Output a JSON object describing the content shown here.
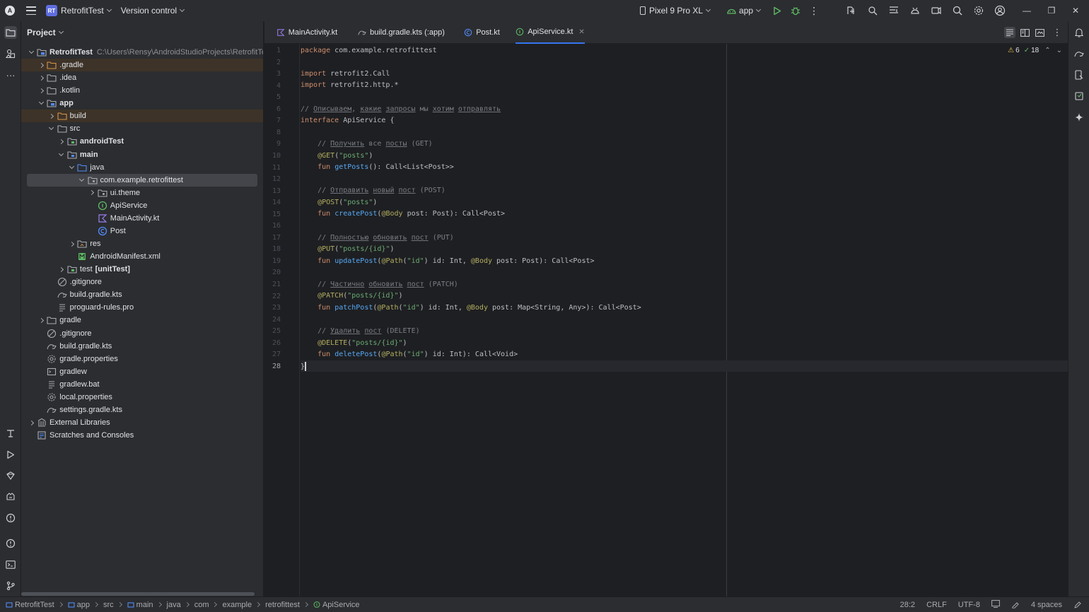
{
  "titlebar": {
    "project_badge": "RT",
    "project_name": "RetrofitTest",
    "vcs_label": "Version control",
    "device": "Pixel 9 Pro XL",
    "run_config": "app"
  },
  "project_panel": {
    "title": "Project",
    "tree": [
      {
        "label": "RetrofitTest",
        "path": "C:\\Users\\Rensy\\AndroidStudioProjects\\RetrofitTest",
        "depth": 0,
        "expander": "open",
        "icon": "module",
        "bold": true
      },
      {
        "label": ".gradle",
        "depth": 1,
        "expander": "closed",
        "icon": "folder-orange",
        "bg": "ignored"
      },
      {
        "label": ".idea",
        "depth": 1,
        "expander": "closed",
        "icon": "folder"
      },
      {
        "label": ".kotlin",
        "depth": 1,
        "expander": "closed",
        "icon": "folder"
      },
      {
        "label": "app",
        "depth": 1,
        "expander": "open",
        "icon": "module",
        "bold": true
      },
      {
        "label": "build",
        "depth": 2,
        "expander": "closed",
        "icon": "folder-orange",
        "bg": "ignored"
      },
      {
        "label": "src",
        "depth": 2,
        "expander": "open",
        "icon": "folder"
      },
      {
        "label": "androidTest",
        "depth": 3,
        "expander": "closed",
        "icon": "folder-test",
        "bold": true
      },
      {
        "label": "main",
        "depth": 3,
        "expander": "open",
        "icon": "folder-src",
        "bold": true
      },
      {
        "label": "java",
        "depth": 4,
        "expander": "open",
        "icon": "folder-blue"
      },
      {
        "label": "com.example.retrofittest",
        "depth": 5,
        "expander": "open",
        "icon": "package",
        "bg": "selected"
      },
      {
        "label": "ui.theme",
        "depth": 6,
        "expander": "closed",
        "icon": "package"
      },
      {
        "label": "ApiService",
        "depth": 6,
        "expander": "none",
        "icon": "kotlin-interface"
      },
      {
        "label": "MainActivity.kt",
        "depth": 6,
        "expander": "none",
        "icon": "kotlin-file"
      },
      {
        "label": "Post",
        "depth": 6,
        "expander": "none",
        "icon": "kotlin-class"
      },
      {
        "label": "res",
        "depth": 4,
        "expander": "closed",
        "icon": "folder-res"
      },
      {
        "label": "AndroidManifest.xml",
        "depth": 4,
        "expander": "none",
        "icon": "manifest"
      },
      {
        "label": "test",
        "suffix": "[unitTest]",
        "depth": 3,
        "expander": "closed",
        "icon": "folder-test"
      },
      {
        "label": ".gitignore",
        "depth": 2,
        "expander": "none",
        "icon": "gitignore"
      },
      {
        "label": "build.gradle.kts",
        "depth": 2,
        "expander": "none",
        "icon": "gradle"
      },
      {
        "label": "proguard-rules.pro",
        "depth": 2,
        "expander": "none",
        "icon": "text-file"
      },
      {
        "label": "gradle",
        "depth": 1,
        "expander": "closed",
        "icon": "folder"
      },
      {
        "label": ".gitignore",
        "depth": 1,
        "expander": "none",
        "icon": "gitignore"
      },
      {
        "label": "build.gradle.kts",
        "depth": 1,
        "expander": "none",
        "icon": "gradle"
      },
      {
        "label": "gradle.properties",
        "depth": 1,
        "expander": "none",
        "icon": "settings-file"
      },
      {
        "label": "gradlew",
        "depth": 1,
        "expander": "none",
        "icon": "terminal-file"
      },
      {
        "label": "gradlew.bat",
        "depth": 1,
        "expander": "none",
        "icon": "text-file"
      },
      {
        "label": "local.properties",
        "depth": 1,
        "expander": "none",
        "icon": "settings-file"
      },
      {
        "label": "settings.gradle.kts",
        "depth": 1,
        "expander": "none",
        "icon": "gradle"
      },
      {
        "label": "External Libraries",
        "depth": 0,
        "expander": "closed",
        "icon": "library"
      },
      {
        "label": "Scratches and Consoles",
        "depth": 0,
        "expander": "none",
        "icon": "scratches"
      }
    ]
  },
  "tabs": [
    {
      "label": "MainActivity.kt",
      "icon": "kotlin-file",
      "active": false
    },
    {
      "label": "build.gradle.kts (:app)",
      "icon": "gradle",
      "active": false
    },
    {
      "label": "Post.kt",
      "icon": "kotlin-class",
      "active": false
    },
    {
      "label": "ApiService.kt",
      "icon": "kotlin-interface",
      "active": true
    }
  ],
  "inspections": {
    "warnings": "6",
    "weak_warnings": "18"
  },
  "editor": {
    "current_line": 28,
    "lines": [
      [
        [
          "k",
          "package "
        ],
        [
          "p",
          "com.example.retrofittest"
        ]
      ],
      [],
      [
        [
          "k",
          "import "
        ],
        [
          "p",
          "retrofit2.Call"
        ]
      ],
      [
        [
          "k",
          "import "
        ],
        [
          "p",
          "retrofit2.http.*"
        ]
      ],
      [],
      [
        [
          "c",
          "// "
        ],
        [
          "cu",
          "Описываем"
        ],
        [
          "c",
          ", "
        ],
        [
          "cu",
          "какие"
        ],
        [
          "c",
          " "
        ],
        [
          "cu",
          "запросы"
        ],
        [
          "c",
          " мы "
        ],
        [
          "cu",
          "хотим"
        ],
        [
          "c",
          " "
        ],
        [
          "cu",
          "отправлять"
        ]
      ],
      [
        [
          "k",
          "interface "
        ],
        [
          "p",
          "ApiService {"
        ]
      ],
      [],
      [
        [
          "p",
          "    "
        ],
        [
          "c",
          "// "
        ],
        [
          "cu",
          "Получить"
        ],
        [
          "c",
          " все "
        ],
        [
          "cu",
          "посты"
        ],
        [
          "c",
          " (GET)"
        ]
      ],
      [
        [
          "p",
          "    "
        ],
        [
          "a",
          "@GET"
        ],
        [
          "p",
          "("
        ],
        [
          "s",
          "\"posts\""
        ],
        [
          "p",
          ")"
        ]
      ],
      [
        [
          "p",
          "    "
        ],
        [
          "k",
          "fun "
        ],
        [
          "f",
          "getPosts"
        ],
        [
          "p",
          "(): Call<List<Post>>"
        ]
      ],
      [],
      [
        [
          "p",
          "    "
        ],
        [
          "c",
          "// "
        ],
        [
          "cu",
          "Отправить"
        ],
        [
          "c",
          " "
        ],
        [
          "cu",
          "новый"
        ],
        [
          "c",
          " "
        ],
        [
          "cu",
          "пост"
        ],
        [
          "c",
          " (POST)"
        ]
      ],
      [
        [
          "p",
          "    "
        ],
        [
          "a",
          "@POST"
        ],
        [
          "p",
          "("
        ],
        [
          "s",
          "\"posts\""
        ],
        [
          "p",
          ")"
        ]
      ],
      [
        [
          "p",
          "    "
        ],
        [
          "k",
          "fun "
        ],
        [
          "f",
          "createPost"
        ],
        [
          "p",
          "("
        ],
        [
          "a",
          "@Body "
        ],
        [
          "p",
          "post: Post): Call<Post>"
        ]
      ],
      [],
      [
        [
          "p",
          "    "
        ],
        [
          "c",
          "// "
        ],
        [
          "cu",
          "Полностью"
        ],
        [
          "c",
          " "
        ],
        [
          "cu",
          "обновить"
        ],
        [
          "c",
          " "
        ],
        [
          "cu",
          "пост"
        ],
        [
          "c",
          " (PUT)"
        ]
      ],
      [
        [
          "p",
          "    "
        ],
        [
          "a",
          "@PUT"
        ],
        [
          "p",
          "("
        ],
        [
          "s",
          "\"posts/{id}\""
        ],
        [
          "p",
          ")"
        ]
      ],
      [
        [
          "p",
          "    "
        ],
        [
          "k",
          "fun "
        ],
        [
          "f",
          "updatePost"
        ],
        [
          "p",
          "("
        ],
        [
          "a",
          "@Path"
        ],
        [
          "p",
          "("
        ],
        [
          "s",
          "\"id\""
        ],
        [
          "p",
          ") id: Int, "
        ],
        [
          "a",
          "@Body "
        ],
        [
          "p",
          "post: Post): Call<Post>"
        ]
      ],
      [],
      [
        [
          "p",
          "    "
        ],
        [
          "c",
          "// "
        ],
        [
          "cu",
          "Частично"
        ],
        [
          "c",
          " "
        ],
        [
          "cu",
          "обновить"
        ],
        [
          "c",
          " "
        ],
        [
          "cu",
          "пост"
        ],
        [
          "c",
          " (PATCH)"
        ]
      ],
      [
        [
          "p",
          "    "
        ],
        [
          "a",
          "@PATCH"
        ],
        [
          "p",
          "("
        ],
        [
          "s",
          "\"posts/{id}\""
        ],
        [
          "p",
          ")"
        ]
      ],
      [
        [
          "p",
          "    "
        ],
        [
          "k",
          "fun "
        ],
        [
          "f",
          "patchPost"
        ],
        [
          "p",
          "("
        ],
        [
          "a",
          "@Path"
        ],
        [
          "p",
          "("
        ],
        [
          "s",
          "\"id\""
        ],
        [
          "p",
          ") id: Int, "
        ],
        [
          "a",
          "@Body "
        ],
        [
          "p",
          "post: Map<String, Any>): Call<Post>"
        ]
      ],
      [],
      [
        [
          "p",
          "    "
        ],
        [
          "c",
          "// "
        ],
        [
          "cu",
          "Удалить"
        ],
        [
          "c",
          " "
        ],
        [
          "cu",
          "пост"
        ],
        [
          "c",
          " (DELETE)"
        ]
      ],
      [
        [
          "p",
          "    "
        ],
        [
          "a",
          "@DELETE"
        ],
        [
          "p",
          "("
        ],
        [
          "s",
          "\"posts/{id}\""
        ],
        [
          "p",
          ")"
        ]
      ],
      [
        [
          "p",
          "    "
        ],
        [
          "k",
          "fun "
        ],
        [
          "f",
          "deletePost"
        ],
        [
          "p",
          "("
        ],
        [
          "a",
          "@Path"
        ],
        [
          "p",
          "("
        ],
        [
          "s",
          "\"id\""
        ],
        [
          "p",
          ") id: Int): Call<Void>"
        ]
      ],
      [
        [
          "p",
          "}"
        ]
      ]
    ]
  },
  "breadcrumbs": [
    {
      "label": "RetrofitTest",
      "icon": "module"
    },
    {
      "label": "app",
      "icon": "module"
    },
    {
      "label": "src",
      "icon": "none"
    },
    {
      "label": "main",
      "icon": "module"
    },
    {
      "label": "java",
      "icon": "none"
    },
    {
      "label": "com",
      "icon": "none"
    },
    {
      "label": "example",
      "icon": "none"
    },
    {
      "label": "retrofittest",
      "icon": "none"
    },
    {
      "label": "ApiService",
      "icon": "kotlin-interface"
    }
  ],
  "statusbar": {
    "position": "28:2",
    "line_separator": "CRLF",
    "encoding": "UTF-8",
    "indent": "4 spaces"
  },
  "colors": {
    "accent": "#3574f0",
    "keyword": "#cf8e6d",
    "string": "#6aab73",
    "annotation": "#b3ae60",
    "function": "#56a8f5",
    "comment": "#7a7e85"
  }
}
